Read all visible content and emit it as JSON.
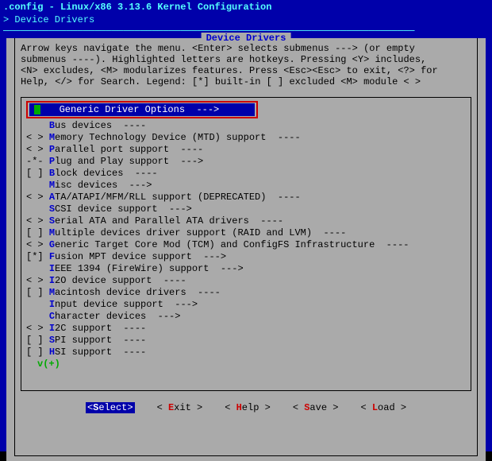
{
  "title": ".config - Linux/x86 3.13.6 Kernel Configuration",
  "breadcrumb": "> Device Drivers ",
  "panel_title": " Device Drivers ",
  "help_lines": [
    "Arrow keys navigate the menu.  <Enter> selects submenus ---> (or empty",
    "submenus ----).  Highlighted letters are hotkeys.  Pressing <Y> includes,",
    "<N> excludes, <M> modularizes features.  Press <Esc><Esc> to exit, <?> for",
    "Help, </> for Search.  Legend: [*] built-in  [ ] excluded  <M> module  < >"
  ],
  "selected": {
    "label": "Generic Driver Options  --->"
  },
  "items": [
    {
      "prefix": "    ",
      "hk": "B",
      "rest": "us devices  ----"
    },
    {
      "prefix": "< > ",
      "hk": "M",
      "rest": "emory Technology Device (MTD) support  ----"
    },
    {
      "prefix": "< > ",
      "hk": "P",
      "rest": "arallel port support  ----"
    },
    {
      "prefix": "-*- ",
      "hk": "P",
      "rest": "lug and Play support  --->"
    },
    {
      "prefix": "[ ] ",
      "hk": "B",
      "rest": "lock devices  ----"
    },
    {
      "prefix": "    ",
      "hk": "M",
      "rest": "isc devices  --->"
    },
    {
      "prefix": "< > ",
      "hk": "A",
      "rest": "TA/ATAPI/MFM/RLL support (DEPRECATED)  ----"
    },
    {
      "prefix": "    ",
      "hk": "S",
      "rest": "CSI device support  --->"
    },
    {
      "prefix": "< > ",
      "hk": "S",
      "rest": "erial ATA and Parallel ATA drivers  ----"
    },
    {
      "prefix": "[ ] ",
      "hk": "M",
      "rest": "ultiple devices driver support (RAID and LVM)  ----"
    },
    {
      "prefix": "< > ",
      "hk": "G",
      "rest": "eneric Target Core Mod (TCM) and ConfigFS Infrastructure  ----"
    },
    {
      "prefix": "[*] ",
      "hk": "F",
      "rest": "usion MPT device support  --->"
    },
    {
      "prefix": "    ",
      "hk": "I",
      "rest": "EEE 1394 (FireWire) support  --->"
    },
    {
      "prefix": "< > ",
      "hk": "I",
      "rest": "2O device support  ----"
    },
    {
      "prefix": "[ ] ",
      "hk": "M",
      "rest": "acintosh device drivers  ----"
    },
    {
      "prefix": "    ",
      "hk": "I",
      "rest": "nput device support  --->"
    },
    {
      "prefix": "    ",
      "hk": "C",
      "rest": "haracter devices  --->"
    },
    {
      "prefix": "< > ",
      "hk": "I",
      "rest": "2C support  ----"
    },
    {
      "prefix": "[ ] ",
      "hk": "S",
      "rest": "PI support  ----"
    },
    {
      "prefix": "[ ] ",
      "hk": "H",
      "rest": "SI support  ----"
    }
  ],
  "more_indicator": "v(+)",
  "buttons": [
    {
      "pre": "<",
      "hk": "S",
      "post": "elect>",
      "selected": true
    },
    {
      "pre": "< ",
      "hk": "E",
      "post": "xit >",
      "selected": false
    },
    {
      "pre": "< ",
      "hk": "H",
      "post": "elp >",
      "selected": false
    },
    {
      "pre": "< ",
      "hk": "S",
      "post": "ave >",
      "selected": false
    },
    {
      "pre": "< ",
      "hk": "L",
      "post": "oad >",
      "selected": false
    }
  ]
}
